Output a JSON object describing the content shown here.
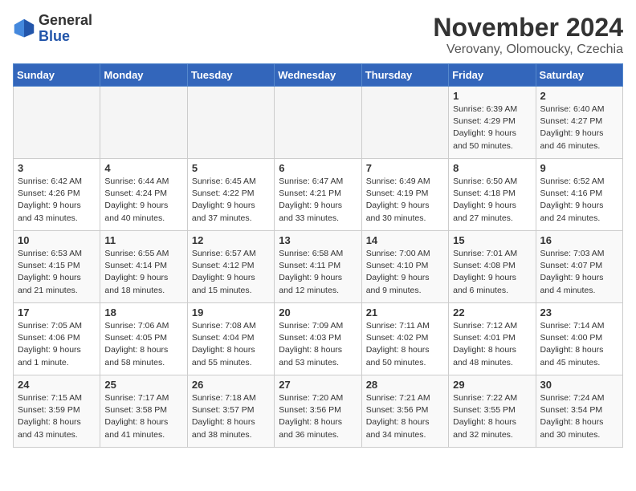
{
  "logo": {
    "general": "General",
    "blue": "Blue"
  },
  "title": "November 2024",
  "location": "Verovany, Olomoucky, Czechia",
  "days_of_week": [
    "Sunday",
    "Monday",
    "Tuesday",
    "Wednesday",
    "Thursday",
    "Friday",
    "Saturday"
  ],
  "weeks": [
    [
      {
        "day": "",
        "info": ""
      },
      {
        "day": "",
        "info": ""
      },
      {
        "day": "",
        "info": ""
      },
      {
        "day": "",
        "info": ""
      },
      {
        "day": "",
        "info": ""
      },
      {
        "day": "1",
        "info": "Sunrise: 6:39 AM\nSunset: 4:29 PM\nDaylight: 9 hours\nand 50 minutes."
      },
      {
        "day": "2",
        "info": "Sunrise: 6:40 AM\nSunset: 4:27 PM\nDaylight: 9 hours\nand 46 minutes."
      }
    ],
    [
      {
        "day": "3",
        "info": "Sunrise: 6:42 AM\nSunset: 4:26 PM\nDaylight: 9 hours\nand 43 minutes."
      },
      {
        "day": "4",
        "info": "Sunrise: 6:44 AM\nSunset: 4:24 PM\nDaylight: 9 hours\nand 40 minutes."
      },
      {
        "day": "5",
        "info": "Sunrise: 6:45 AM\nSunset: 4:22 PM\nDaylight: 9 hours\nand 37 minutes."
      },
      {
        "day": "6",
        "info": "Sunrise: 6:47 AM\nSunset: 4:21 PM\nDaylight: 9 hours\nand 33 minutes."
      },
      {
        "day": "7",
        "info": "Sunrise: 6:49 AM\nSunset: 4:19 PM\nDaylight: 9 hours\nand 30 minutes."
      },
      {
        "day": "8",
        "info": "Sunrise: 6:50 AM\nSunset: 4:18 PM\nDaylight: 9 hours\nand 27 minutes."
      },
      {
        "day": "9",
        "info": "Sunrise: 6:52 AM\nSunset: 4:16 PM\nDaylight: 9 hours\nand 24 minutes."
      }
    ],
    [
      {
        "day": "10",
        "info": "Sunrise: 6:53 AM\nSunset: 4:15 PM\nDaylight: 9 hours\nand 21 minutes."
      },
      {
        "day": "11",
        "info": "Sunrise: 6:55 AM\nSunset: 4:14 PM\nDaylight: 9 hours\nand 18 minutes."
      },
      {
        "day": "12",
        "info": "Sunrise: 6:57 AM\nSunset: 4:12 PM\nDaylight: 9 hours\nand 15 minutes."
      },
      {
        "day": "13",
        "info": "Sunrise: 6:58 AM\nSunset: 4:11 PM\nDaylight: 9 hours\nand 12 minutes."
      },
      {
        "day": "14",
        "info": "Sunrise: 7:00 AM\nSunset: 4:10 PM\nDaylight: 9 hours\nand 9 minutes."
      },
      {
        "day": "15",
        "info": "Sunrise: 7:01 AM\nSunset: 4:08 PM\nDaylight: 9 hours\nand 6 minutes."
      },
      {
        "day": "16",
        "info": "Sunrise: 7:03 AM\nSunset: 4:07 PM\nDaylight: 9 hours\nand 4 minutes."
      }
    ],
    [
      {
        "day": "17",
        "info": "Sunrise: 7:05 AM\nSunset: 4:06 PM\nDaylight: 9 hours\nand 1 minute."
      },
      {
        "day": "18",
        "info": "Sunrise: 7:06 AM\nSunset: 4:05 PM\nDaylight: 8 hours\nand 58 minutes."
      },
      {
        "day": "19",
        "info": "Sunrise: 7:08 AM\nSunset: 4:04 PM\nDaylight: 8 hours\nand 55 minutes."
      },
      {
        "day": "20",
        "info": "Sunrise: 7:09 AM\nSunset: 4:03 PM\nDaylight: 8 hours\nand 53 minutes."
      },
      {
        "day": "21",
        "info": "Sunrise: 7:11 AM\nSunset: 4:02 PM\nDaylight: 8 hours\nand 50 minutes."
      },
      {
        "day": "22",
        "info": "Sunrise: 7:12 AM\nSunset: 4:01 PM\nDaylight: 8 hours\nand 48 minutes."
      },
      {
        "day": "23",
        "info": "Sunrise: 7:14 AM\nSunset: 4:00 PM\nDaylight: 8 hours\nand 45 minutes."
      }
    ],
    [
      {
        "day": "24",
        "info": "Sunrise: 7:15 AM\nSunset: 3:59 PM\nDaylight: 8 hours\nand 43 minutes."
      },
      {
        "day": "25",
        "info": "Sunrise: 7:17 AM\nSunset: 3:58 PM\nDaylight: 8 hours\nand 41 minutes."
      },
      {
        "day": "26",
        "info": "Sunrise: 7:18 AM\nSunset: 3:57 PM\nDaylight: 8 hours\nand 38 minutes."
      },
      {
        "day": "27",
        "info": "Sunrise: 7:20 AM\nSunset: 3:56 PM\nDaylight: 8 hours\nand 36 minutes."
      },
      {
        "day": "28",
        "info": "Sunrise: 7:21 AM\nSunset: 3:56 PM\nDaylight: 8 hours\nand 34 minutes."
      },
      {
        "day": "29",
        "info": "Sunrise: 7:22 AM\nSunset: 3:55 PM\nDaylight: 8 hours\nand 32 minutes."
      },
      {
        "day": "30",
        "info": "Sunrise: 7:24 AM\nSunset: 3:54 PM\nDaylight: 8 hours\nand 30 minutes."
      }
    ]
  ]
}
